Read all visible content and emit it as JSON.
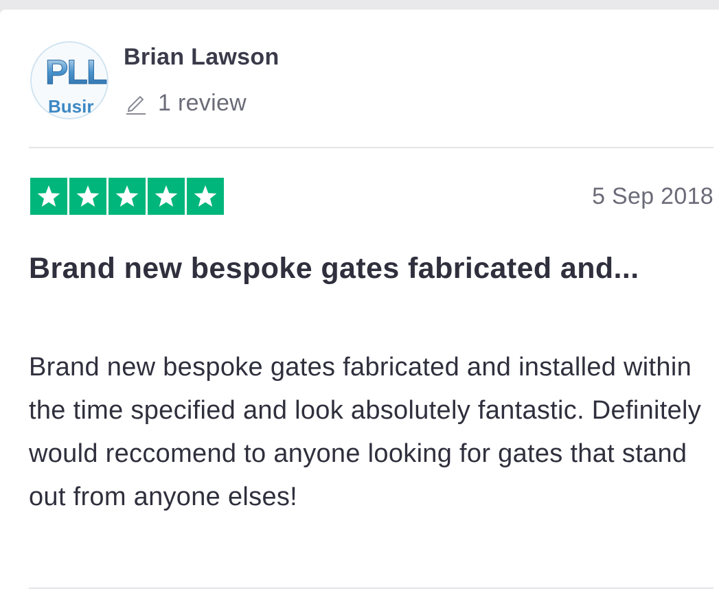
{
  "reviewer": {
    "name": "Brian Lawson",
    "review_count": "1 review",
    "avatar": {
      "logo_text": "PLL",
      "logo_subtext": "Busir",
      "colors": {
        "logo": "#3d88c4",
        "ring": "#cfe3f1"
      }
    }
  },
  "review": {
    "rating": 5,
    "max_rating": 5,
    "star_color": "#00b67a",
    "date": "5 Sep 2018",
    "title": "Brand new bespoke gates fabricated and...",
    "body": "Brand new bespoke gates fabricated and installed within the time specified and look absolutely fantastic. Definitely would reccomend to anyone looking for gates that stand out from anyone elses!"
  },
  "icons": {
    "pencil": "pencil-icon",
    "star": "star-icon"
  }
}
